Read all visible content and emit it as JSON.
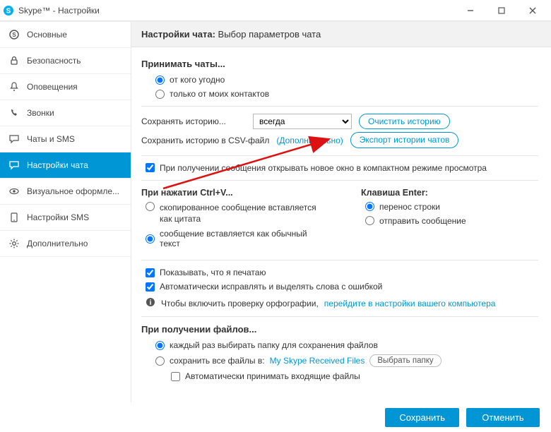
{
  "window": {
    "title": "Skype™ - Настройки"
  },
  "sidebar": {
    "items": [
      {
        "label": "Основные",
        "icon": "skype"
      },
      {
        "label": "Безопасность",
        "icon": "lock"
      },
      {
        "label": "Оповещения",
        "icon": "bell"
      },
      {
        "label": "Звонки",
        "icon": "phone"
      },
      {
        "label": "Чаты и SMS",
        "icon": "chat"
      },
      {
        "label": "Настройки чата",
        "icon": "chat-settings",
        "active": true
      },
      {
        "label": "Визуальное оформле...",
        "icon": "eye"
      },
      {
        "label": "Настройки SMS",
        "icon": "sms"
      },
      {
        "label": "Дополнительно",
        "icon": "gear"
      }
    ]
  },
  "header": {
    "bold": "Настройки чата:",
    "rest": "Выбор параметров чата"
  },
  "accept": {
    "title": "Принимать чаты...",
    "opt_anyone": "от кого угодно",
    "opt_contacts": "только от моих контактов"
  },
  "history": {
    "label": "Сохранять историю...",
    "select_value": "всегда",
    "clear_btn": "Очистить историю",
    "csv_label": "Сохранить историю в CSV-файл",
    "csv_more": "(Дополнительно)",
    "export_btn": "Экспорт истории чатов"
  },
  "compact_check": "При получении сообщения открывать новое окно в компактном режиме просмотра",
  "ctrl_v": {
    "title": "При нажатии Ctrl+V...",
    "opt_quote": "скопированное сообщение вставляется как цитата",
    "opt_plain": "сообщение вставляется как обычный текст"
  },
  "enter": {
    "title": "Клавиша Enter:",
    "opt_newline": "перенос строки",
    "opt_send": "отправить сообщение"
  },
  "checks": {
    "typing": "Показывать, что я печатаю",
    "spell": "Автоматически исправлять и выделять слова с ошибкой",
    "spell_info_pre": "Чтобы включить проверку орфографии,",
    "spell_info_link": "перейдите в настройки вашего компьютера"
  },
  "files": {
    "title": "При получении файлов...",
    "opt_pick": "каждый раз выбирать папку для сохранения файлов",
    "opt_folder_pre": "сохранить все файлы в:",
    "opt_folder_link": "My Skype Received Files",
    "choose_btn": "Выбрать папку",
    "auto_accept": "Автоматически принимать входящие файлы"
  },
  "footer": {
    "save": "Сохранить",
    "cancel": "Отменить"
  }
}
